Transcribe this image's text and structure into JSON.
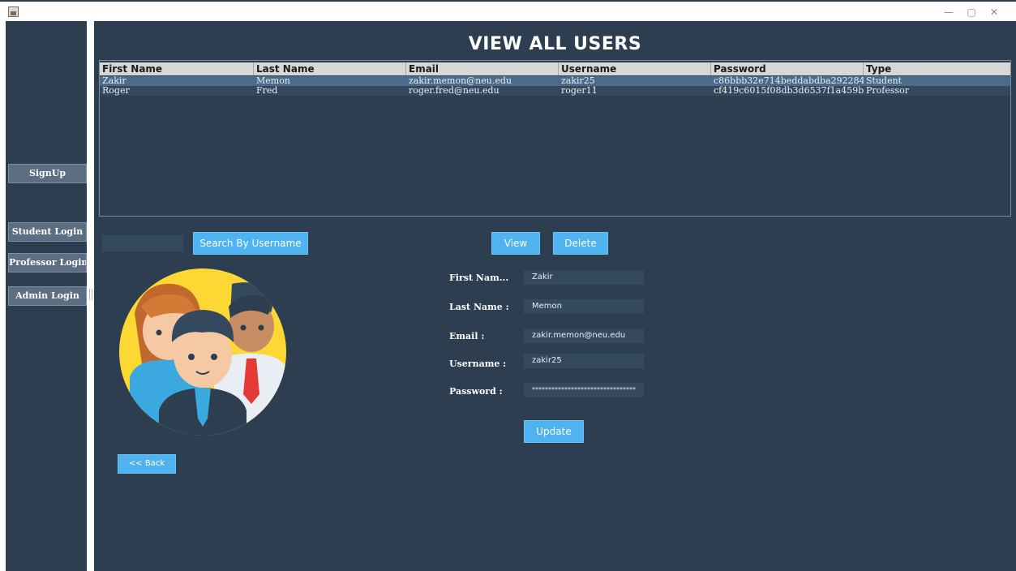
{
  "window": {
    "controls": [
      "—",
      "▢",
      "✕"
    ]
  },
  "sidebar": {
    "signup": "SignUp",
    "student_login": "Student Login",
    "professor_login": "Professor Login",
    "admin_login": "Admin Login"
  },
  "page": {
    "title": "VIEW ALL USERS"
  },
  "table": {
    "columns": [
      "First Name",
      "Last Name",
      "Email",
      "Username",
      "Password",
      "Type"
    ],
    "rows": [
      [
        "Zakir",
        "Memon",
        "zakir.memon@neu.edu",
        "zakir25",
        "c86bbb32e714beddabdba292284...",
        "Student"
      ],
      [
        "Roger",
        "Fred",
        "roger.fred@neu.edu",
        "roger11",
        "cf419c6015f08db3d6537f1a459b...",
        "Professor"
      ]
    ]
  },
  "search": {
    "value": "",
    "button_label": "Search By Username"
  },
  "actions": {
    "view": "View",
    "delete": "Delete",
    "update": "Update",
    "back": "<< Back"
  },
  "form": {
    "first_name_label": "First Nam...",
    "first_name_value": "Zakir",
    "last_name_label": "Last Name :",
    "last_name_value": "Memon",
    "email_label": "Email :",
    "email_value": "zakir.memon@neu.edu",
    "username_label": "Username :",
    "username_value": "zakir25",
    "password_label": "Password :",
    "password_value": "********************************"
  },
  "colors": {
    "background": "#2c3e50",
    "accent_button": "#4fb3f0",
    "selected_row": "#4a6b8a",
    "sidebar_button": "#5b6e82"
  },
  "icons": [
    "app-icon",
    "users-group-illustration"
  ]
}
